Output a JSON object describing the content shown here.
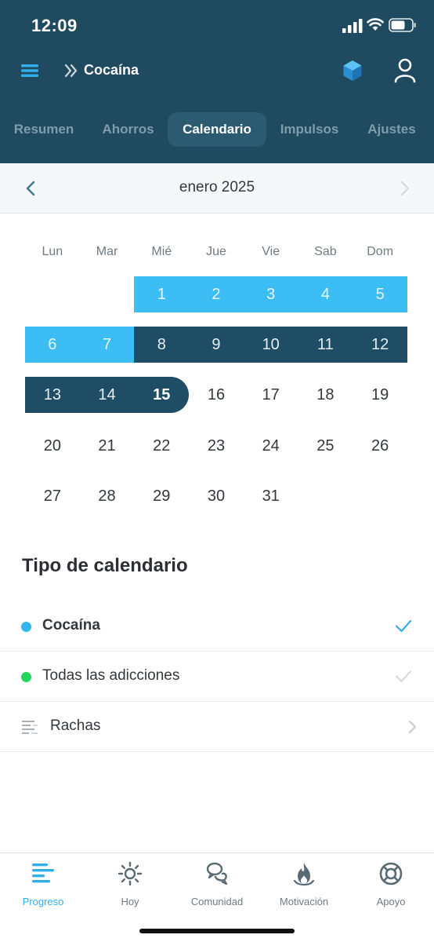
{
  "status_bar": {
    "time": "12:09"
  },
  "nav": {
    "title": "Cocaína"
  },
  "tabs": [
    {
      "label": "Resumen",
      "active": false
    },
    {
      "label": "Ahorros",
      "active": false
    },
    {
      "label": "Calendario",
      "active": true
    },
    {
      "label": "Impulsos",
      "active": false
    },
    {
      "label": "Ajustes",
      "active": false
    }
  ],
  "month_nav": {
    "label": "enero 2025"
  },
  "calendar": {
    "weekdays": [
      "Lun",
      "Mar",
      "Mié",
      "Jue",
      "Vie",
      "Sab",
      "Dom"
    ],
    "first_weekday_index": 2,
    "days_in_month": 31,
    "today": 15,
    "light_highlight_days": [
      1,
      2,
      3,
      4,
      5,
      6,
      7
    ],
    "dark_highlight_days": [
      8,
      9,
      10,
      11,
      12,
      13,
      14,
      15
    ],
    "colors": {
      "light": "#3cbdf4",
      "dark": "#1f4d65"
    }
  },
  "calendar_type": {
    "title": "Tipo de calendario",
    "options": [
      {
        "label": "Cocaína",
        "dot_color": "#33b5f0",
        "selected": true
      },
      {
        "label": "Todas las adicciones",
        "dot_color": "#22d65d",
        "selected": false
      }
    ],
    "streaks_label": "Rachas"
  },
  "bottom_tabs": [
    {
      "label": "Progreso",
      "icon": "progress-icon",
      "active": true
    },
    {
      "label": "Hoy",
      "icon": "sun-icon",
      "active": false
    },
    {
      "label": "Comunidad",
      "icon": "community-icon",
      "active": false
    },
    {
      "label": "Motivación",
      "icon": "flame-icon",
      "active": false
    },
    {
      "label": "Apoyo",
      "icon": "lifebuoy-icon",
      "active": false
    }
  ],
  "colors": {
    "header": "#204a60",
    "accent": "#33aee8"
  }
}
